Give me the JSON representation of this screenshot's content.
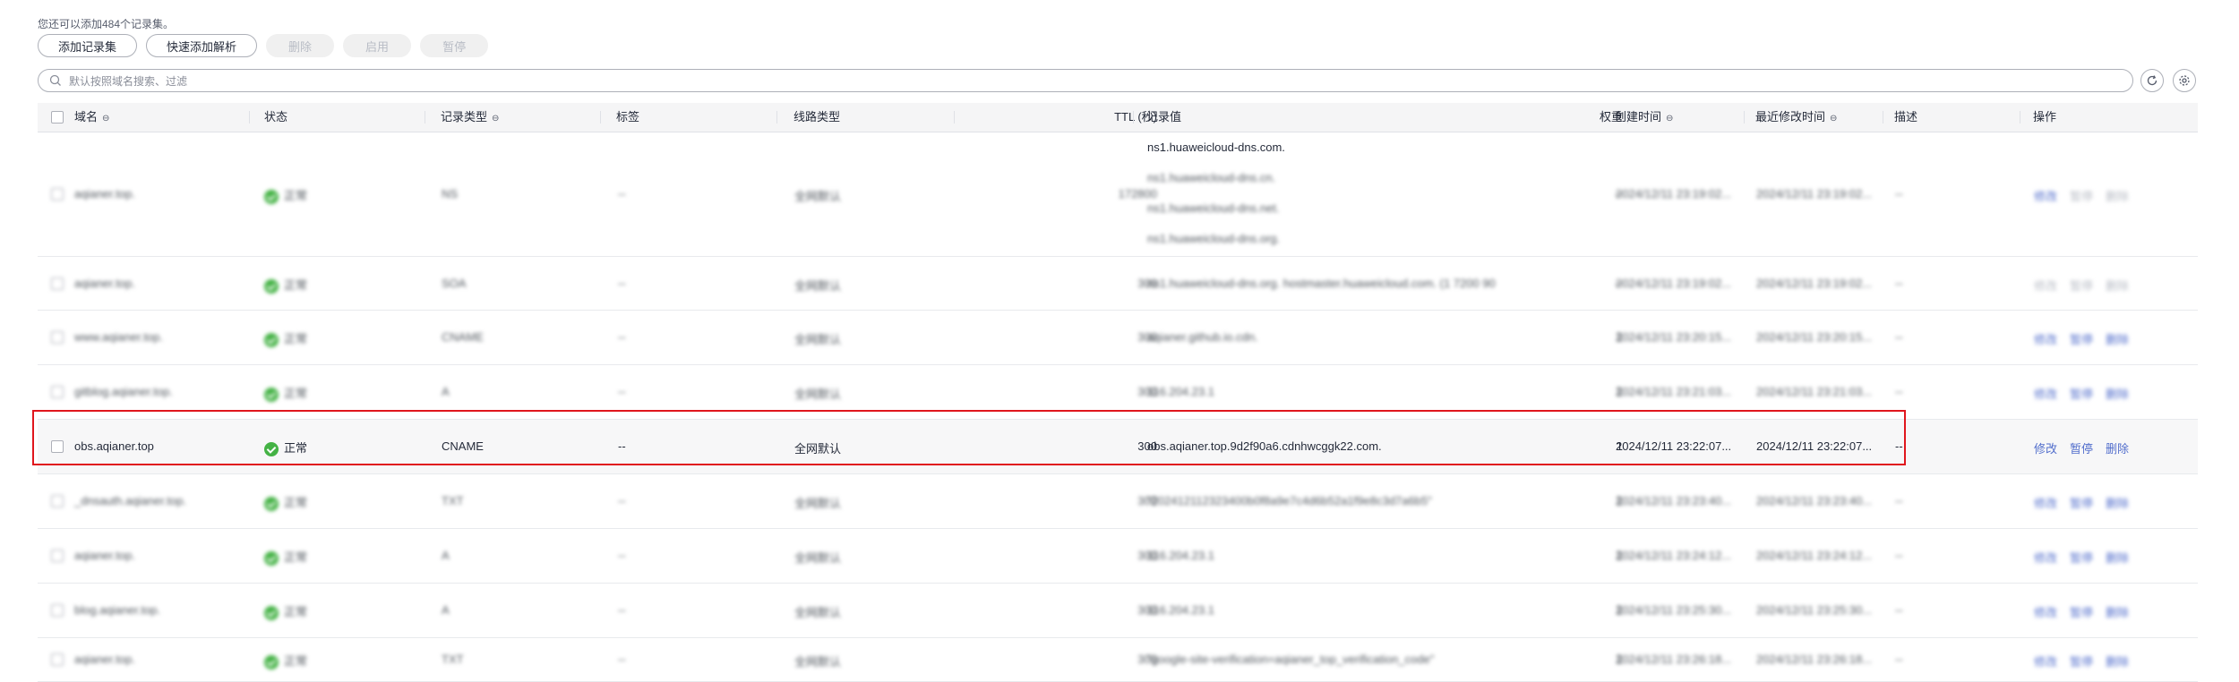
{
  "hint_text": "您还可以添加484个记录集。",
  "toolbar": {
    "add_label": "添加记录集",
    "quick_add_label": "快速添加解析",
    "delete_label": "删除",
    "enable_label": "启用",
    "pause_label": "暂停"
  },
  "search": {
    "placeholder": "默认按照域名搜索、过滤"
  },
  "columns": {
    "domain": "域名",
    "status": "状态",
    "type": "记录类型",
    "tag": "标签",
    "line": "线路类型",
    "ttl": "TTL (秒)",
    "value": "记录值",
    "weight": "权重",
    "created": "创建时间",
    "modified": "最近修改时间",
    "desc": "描述",
    "ops": "操作"
  },
  "rows": [
    {
      "domain": "aqianer.top.",
      "status": "正常",
      "type": "NS",
      "tag": "--",
      "line": "全网默认",
      "ttl": "172800",
      "values": [
        "ns1.huaweicloud-dns.com.",
        "ns1.huaweicloud-dns.cn.",
        "ns1.huaweicloud-dns.net.",
        "ns1.huaweicloud-dns.org."
      ],
      "weight": "--",
      "created": "2024/12/11 23:19:02...",
      "modified": "2024/12/11 23:19:02...",
      "desc": "--",
      "edit": "修改",
      "pause": "暂停",
      "delete": "删除"
    },
    {
      "domain": "aqianer.top.",
      "status": "正常",
      "type": "SOA",
      "tag": "--",
      "line": "全网默认",
      "ttl": "300",
      "values": [
        "ns1.huaweicloud-dns.org. hostmaster.huaweicloud.com. (1 7200 90"
      ],
      "weight": "--",
      "created": "2024/12/11 23:19:02...",
      "modified": "2024/12/11 23:19:02...",
      "desc": "--",
      "edit": "修改",
      "pause": "暂停",
      "delete": "删除"
    },
    {
      "domain": "www.aqianer.top.",
      "status": "正常",
      "type": "CNAME",
      "tag": "--",
      "line": "全网默认",
      "ttl": "300",
      "values": [
        "aqianer.github.io.cdn."
      ],
      "weight": "1",
      "created": "2024/12/11 23:20:15...",
      "modified": "2024/12/11 23:20:15...",
      "desc": "--",
      "edit": "修改",
      "pause": "暂停",
      "delete": "删除"
    },
    {
      "domain": "gitblog.aqianer.top.",
      "status": "正常",
      "type": "A",
      "tag": "--",
      "line": "全网默认",
      "ttl": "300",
      "values": [
        "116.204.23.1"
      ],
      "weight": "1",
      "created": "2024/12/11 23:21:03...",
      "modified": "2024/12/11 23:21:03...",
      "desc": "--",
      "edit": "修改",
      "pause": "暂停",
      "delete": "删除"
    },
    {
      "domain": "obs.aqianer.top",
      "status": "正常",
      "type": "CNAME",
      "tag": "--",
      "line": "全网默认",
      "ttl": "300",
      "values": [
        "obs.aqianer.top.9d2f90a6.cdnhwcggk22.com."
      ],
      "weight": "1",
      "created": "2024/12/11 23:22:07...",
      "modified": "2024/12/11 23:22:07...",
      "desc": "--",
      "edit": "修改",
      "pause": "暂停",
      "delete": "删除"
    },
    {
      "domain": "_dnsauth.aqianer.top.",
      "status": "正常",
      "type": "TXT",
      "tag": "--",
      "line": "全网默认",
      "ttl": "300",
      "values": [
        "\"202412112323400b0f8a9e7c4d6b52a1f9e8c3d7a6b5\""
      ],
      "weight": "1",
      "created": "2024/12/11 23:23:40...",
      "modified": "2024/12/11 23:23:40...",
      "desc": "--",
      "edit": "修改",
      "pause": "暂停",
      "delete": "删除"
    },
    {
      "domain": "aqianer.top.",
      "status": "正常",
      "type": "A",
      "tag": "--",
      "line": "全网默认",
      "ttl": "300",
      "values": [
        "116.204.23.1"
      ],
      "weight": "1",
      "created": "2024/12/11 23:24:12...",
      "modified": "2024/12/11 23:24:12...",
      "desc": "--",
      "edit": "修改",
      "pause": "暂停",
      "delete": "删除"
    },
    {
      "domain": "blog.aqianer.top.",
      "status": "正常",
      "type": "A",
      "tag": "--",
      "line": "全网默认",
      "ttl": "300",
      "values": [
        "116.204.23.1"
      ],
      "weight": "1",
      "created": "2024/12/11 23:25:30...",
      "modified": "2024/12/11 23:25:30...",
      "desc": "--",
      "edit": "修改",
      "pause": "暂停",
      "delete": "删除"
    },
    {
      "domain": "aqianer.top.",
      "status": "正常",
      "type": "TXT",
      "tag": "--",
      "line": "全网默认",
      "ttl": "300",
      "values": [
        "\"google-site-verification=aqianer_top_verification_code\""
      ],
      "weight": "1",
      "created": "2024/12/11 23:26:18...",
      "modified": "2024/12/11 23:26:18...",
      "desc": "--",
      "edit": "修改",
      "pause": "暂停",
      "delete": "删除"
    }
  ]
}
